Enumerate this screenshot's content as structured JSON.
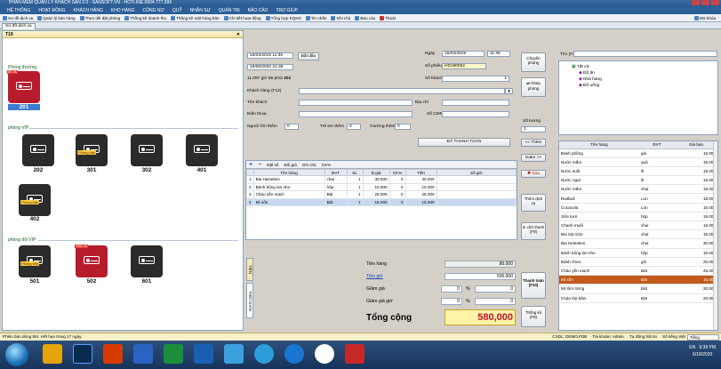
{
  "window": {
    "title": "PHẦN MỀM QUẢN LÝ KHÁCH SẠN 2.0 - SANSOFT.VN - HOTLINE 0904.777.996"
  },
  "menu": [
    "HỆ THỐNG",
    "HOẠT ĐỘNG",
    "KHÁCH HÀNG",
    "KHO HÀNG",
    "CÔNG NỢ",
    "QUỸ",
    "NHÂN SỰ",
    "QUẢN TRỊ",
    "BÁO CÁO",
    "TRỢ GIÚP"
  ],
  "toolbar": [
    "Sơ đồ dịch vụ",
    "Quản lý bán hàng",
    "Theo dõi đặt phòng",
    "Thống kê doanh thu",
    "Thống kê mặt hàng bán",
    "Chi tiết hoạt động",
    "Tổng hợp KQKD",
    "Tin nhắn",
    "Ghi chú",
    "Báo cáo",
    "Thoát"
  ],
  "toolbar_right": "Mở khóa",
  "tab": "Sơ đồ dịch vụ",
  "left": {
    "header": "T19",
    "groups": [
      "Phòng thường",
      "phòng VIP",
      "phòng đôi VIP"
    ],
    "rooms": [
      {
        "name": "201",
        "tag": "50 TA",
        "selected": true
      },
      {
        "name": "202",
        "tag": ""
      },
      {
        "name": "301",
        "tag": "Phòng bẩn"
      },
      {
        "name": "302",
        "tag": ""
      },
      {
        "name": "401",
        "tag": ""
      },
      {
        "name": "402",
        "tag": "Phòng bẩn"
      },
      {
        "name": "501",
        "tag": "Phòng bẩn"
      },
      {
        "name": "502",
        "tag": "TRẢ 18"
      },
      {
        "name": "601",
        "tag": ""
      }
    ]
  },
  "form": {
    "checkin": "15/03/2019 11:35",
    "checkout": "19/06/2020 21:38",
    "btn_start": "Bắt đầu",
    "duration": "11.097 giờ 55 phút",
    "duration_room": "201",
    "date_label": "Ngày",
    "date_value": "15/03/2019",
    "time_value": "11:35",
    "invoice_label": "Số phiếu",
    "invoice_value": "HD190002",
    "guests_label": "Số khách",
    "guests_value": "1",
    "customer_label": "Khách hàng (F12)",
    "name_label": "Tên khách",
    "address_label": "Địa chỉ",
    "phone_label": "Điện thoại",
    "idcard_label": "Số CMND",
    "advance_label": "Người lớn thêm",
    "advance_value": "0",
    "child_label": "Trẻ em thêm",
    "child_value": "0",
    "deposit_label": "Giường thêm",
    "deposit_value": "0",
    "paid_btn": "ĐÃ THANH TOÁN"
  },
  "grid": {
    "tools": [
      "Đặt số",
      "Đổi giá",
      "Ghi chú",
      "CK%"
    ],
    "columns": [
      "",
      "Tên hàng",
      "ĐVT",
      "SL",
      "Đ.giá",
      "CK%",
      "Tiền",
      "Số giờ"
    ],
    "rows": [
      [
        "1",
        "Bia Heineken",
        "chai",
        "1",
        "30.000",
        "0",
        "30.000",
        ""
      ],
      [
        "2",
        "Bánh bông lan nho",
        "hộp",
        "1",
        "10.000",
        "0",
        "10.000",
        ""
      ],
      [
        "3",
        "Cháo yến mạch",
        "Bát",
        "1",
        "25.000",
        "0",
        "25.000",
        ""
      ],
      [
        "4",
        "Mì xốn",
        "Bát",
        "1",
        "15.000",
        "0",
        "15.000",
        ""
      ]
    ]
  },
  "side_tabs": [
    "TIỀN",
    "THỜI GIAN"
  ],
  "totals": {
    "goods_label": "Tiền hàng",
    "goods_value": "80.000",
    "room_label": "Tiền giờ",
    "room_value": "500.000",
    "discount_label": "Giảm giá",
    "discount_pct": "0",
    "discount_value": "0",
    "discount2_label": "Giảm giá giờ",
    "discount2_pct": "0",
    "discount2_value": "0",
    "total_label": "Tổng cộng",
    "total_value": "580,000"
  },
  "actions": {
    "move": "Chuyển phòng",
    "merge": "Ghép phòng",
    "qty_label": "Số lượng",
    "qty_value": "1",
    "add": "<< Thêm",
    "minus": "Giảm >>",
    "delete": "Xóa",
    "service": "Thêm dịch vụ",
    "print": "In chờ thanh (F9)",
    "checkout": "Thanh toán (F10)",
    "print_bill": "Thống kê (F8)"
  },
  "right": {
    "search_label": "Tìm (F3)",
    "tree": [
      "Tất cả",
      "Đồ ăn",
      "Nhà hàng",
      "Đồ uống"
    ],
    "columns": [
      "Tên hàng",
      "ĐVT",
      "Giá bán"
    ],
    "items": [
      [
        "Bánh phồng",
        "gói",
        "10.000"
      ],
      [
        "Nước mắm",
        "quả",
        "15.000"
      ],
      [
        "Nước suối",
        "lít",
        "15.000"
      ],
      [
        "Nước ngọt",
        "lít",
        "15.000"
      ],
      [
        "Nước mắm",
        "chai",
        "15.000"
      ],
      [
        "Redbull",
        "Lon",
        "15.000"
      ],
      [
        "Cocacola",
        "Lon",
        "15.000"
      ],
      [
        "Sữa tươi",
        "hộp",
        "15.000"
      ],
      [
        "Chanh muối",
        "chai",
        "15.000"
      ],
      [
        "Bia Sài Gòn",
        "chai",
        "15.000"
      ],
      [
        "Bia Heineken",
        "chai",
        "30.000"
      ],
      [
        "Bánh bông lan nho",
        "hộp",
        "10.000"
      ],
      [
        "Bánh Oreo",
        "gói",
        "20.000"
      ],
      [
        "Cháo yến mạch",
        "Bát",
        "25.000"
      ],
      [
        "Mì xốn",
        "Bát",
        "15.000"
      ],
      [
        "Mì tôm trứng",
        "Bát",
        "20.000"
      ],
      [
        "Cháo thịt băm",
        "Bát",
        "20.000"
      ]
    ],
    "selected_index": 14
  },
  "status": {
    "left": "Phiên bản dùng thử. Hết hạn trong 17 ngày.",
    "items": [
      "CSDL: DEMO.FDB",
      "Tài khoản: Admin",
      "Tự động bật tin",
      "Số tiếng Việt"
    ],
    "combo": "Tiếng"
  },
  "taskbar": {
    "lang": "EN",
    "time": "9:38 PM",
    "date": "6/19/2020"
  }
}
